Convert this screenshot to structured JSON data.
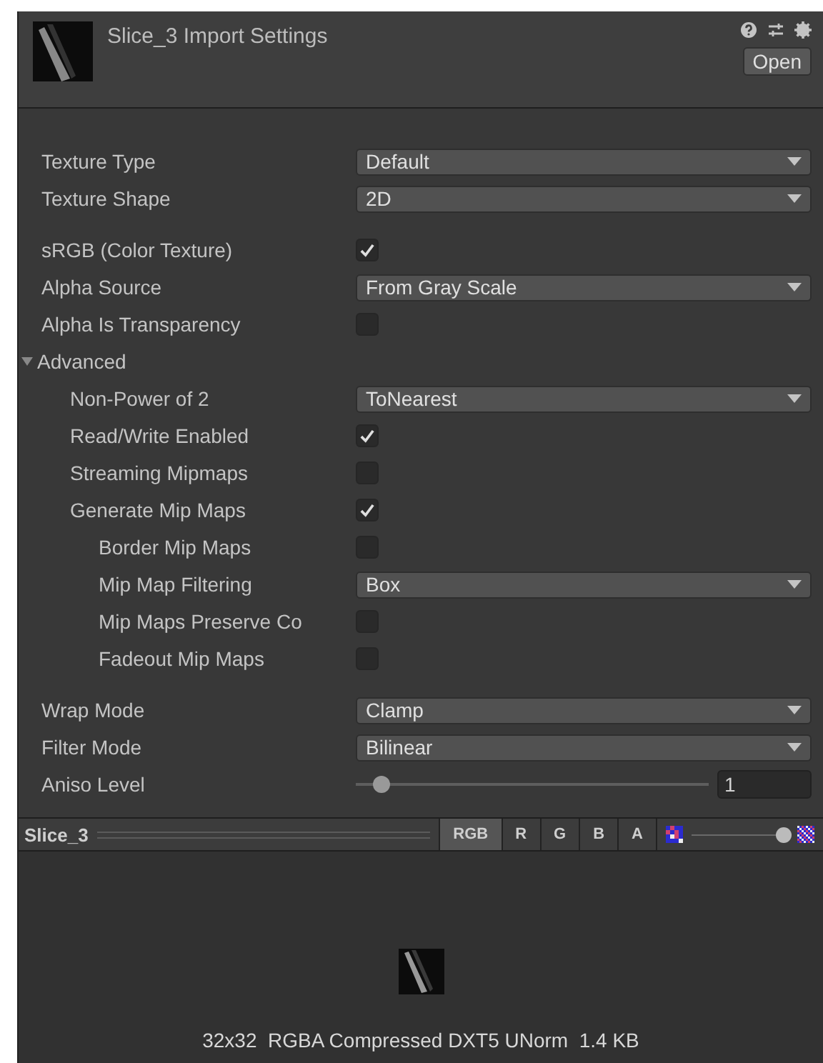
{
  "header": {
    "title": "Slice_3 Import Settings",
    "open_button": "Open"
  },
  "sections": [
    {
      "rows": [
        {
          "kind": "dropdown",
          "label": "Texture Type",
          "value": "Default"
        },
        {
          "kind": "dropdown",
          "label": "Texture Shape",
          "value": "2D"
        }
      ]
    },
    {
      "rows": [
        {
          "kind": "checkbox",
          "label": "sRGB (Color Texture)",
          "checked": true
        },
        {
          "kind": "dropdown",
          "label": "Alpha Source",
          "value": "From Gray Scale"
        },
        {
          "kind": "checkbox",
          "label": "Alpha Is Transparency",
          "checked": false
        },
        {
          "kind": "foldout",
          "label": "Advanced",
          "expanded": true,
          "children": [
            {
              "kind": "dropdown",
              "label": "Non-Power of 2",
              "value": "ToNearest"
            },
            {
              "kind": "checkbox",
              "label": "Read/Write Enabled",
              "checked": true
            },
            {
              "kind": "checkbox",
              "label": "Streaming Mipmaps",
              "checked": false
            },
            {
              "kind": "checkbox",
              "label": "Generate Mip Maps",
              "checked": true,
              "children": [
                {
                  "kind": "checkbox",
                  "label": "Border Mip Maps",
                  "checked": false
                },
                {
                  "kind": "dropdown",
                  "label": "Mip Map Filtering",
                  "value": "Box"
                },
                {
                  "kind": "checkbox",
                  "label": "Mip Maps Preserve Co",
                  "checked": false
                },
                {
                  "kind": "checkbox",
                  "label": "Fadeout Mip Maps",
                  "checked": false
                }
              ]
            }
          ]
        }
      ]
    },
    {
      "rows": [
        {
          "kind": "dropdown",
          "label": "Wrap Mode",
          "value": "Clamp"
        },
        {
          "kind": "dropdown",
          "label": "Filter Mode",
          "value": "Bilinear"
        },
        {
          "kind": "slider",
          "label": "Aniso Level",
          "level": 0.05,
          "value": "1"
        }
      ]
    }
  ],
  "preview_toolbar": {
    "name": "Slice_3",
    "channels": [
      {
        "label": "RGB",
        "selected": true
      },
      {
        "label": "R",
        "selected": false
      },
      {
        "label": "G",
        "selected": false
      },
      {
        "label": "B",
        "selected": false
      },
      {
        "label": "A",
        "selected": false
      }
    ],
    "mip_slider": {
      "level": 0.95
    }
  },
  "preview": {
    "info": "32x32  RGBA Compressed DXT5 UNorm  1.4 KB"
  }
}
